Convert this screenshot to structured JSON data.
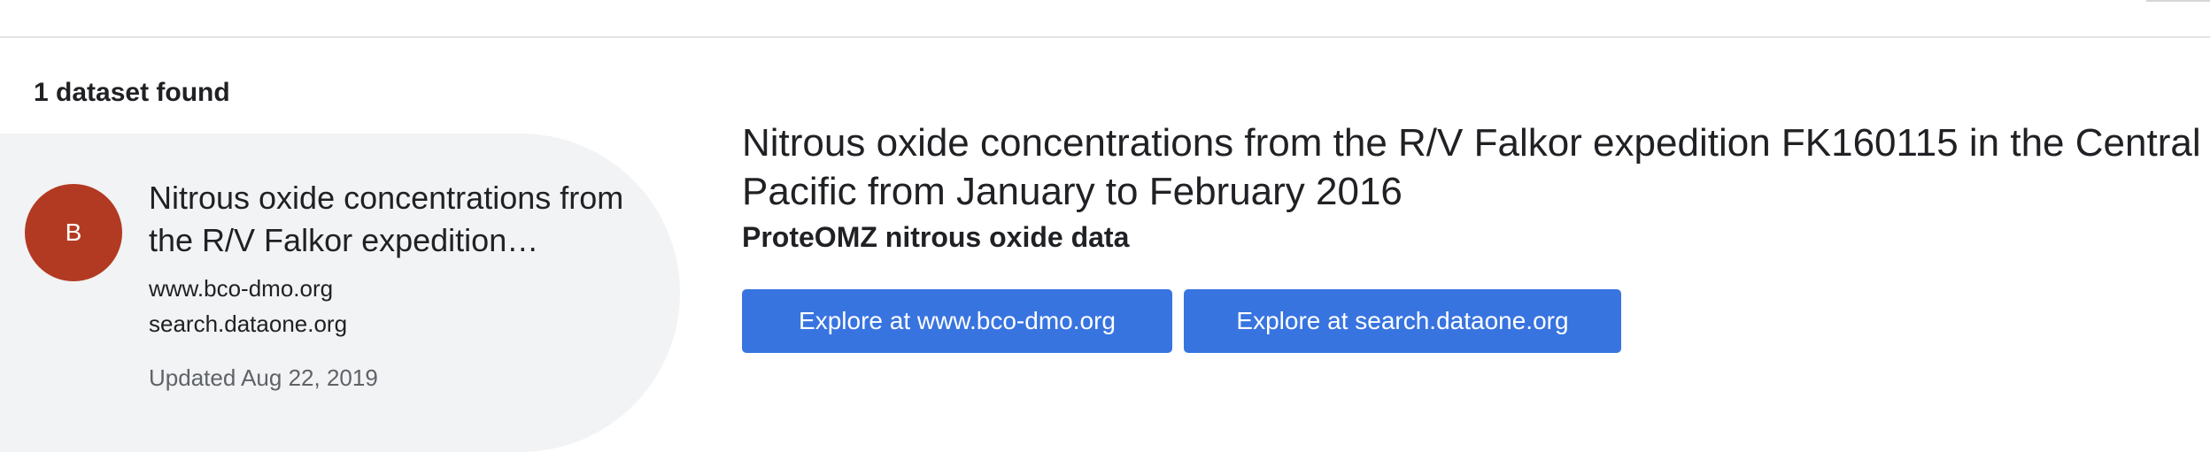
{
  "results": {
    "count_label": "1 dataset found"
  },
  "result_card": {
    "avatar_letter": "B",
    "title": "Nitrous oxide concentrations from the R/V Falkor expedition FK160115 in the Central Pacific from January to February 2016",
    "sources": [
      "www.bco-dmo.org",
      "search.dataone.org"
    ],
    "updated": "Updated Aug 22, 2019"
  },
  "detail": {
    "title": "Nitrous oxide concentrations from the R/V Falkor expedition FK160115 in the Central Pacific from January to February 2016",
    "subtitle": "ProteOMZ nitrous oxide data",
    "buttons": [
      {
        "label": "Explore at www.bco-dmo.org"
      },
      {
        "label": "Explore at search.dataone.org"
      }
    ]
  },
  "colors": {
    "avatar": "#b33a22",
    "button": "#3874e0",
    "card_background": "#f1f3f4",
    "muted_text": "#5f6368"
  }
}
